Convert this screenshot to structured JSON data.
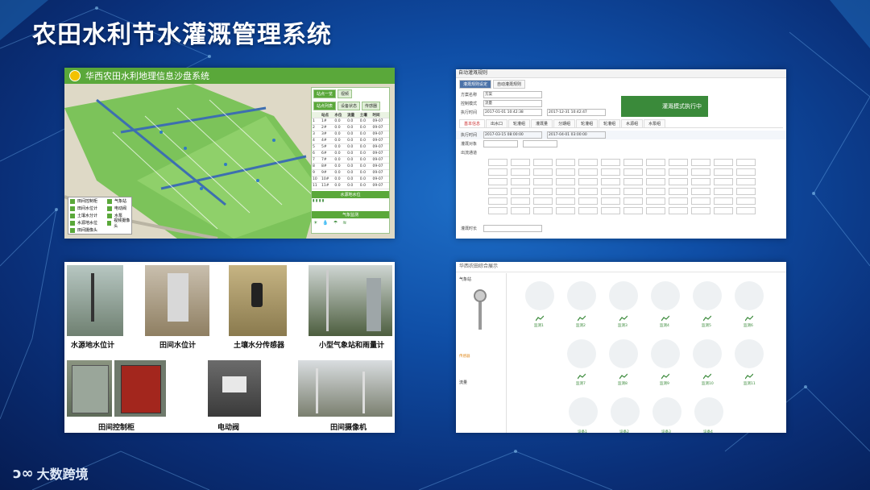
{
  "slide_title": "农田水利节水灌溉管理系统",
  "brand": "大数跨境",
  "gis": {
    "window_title": "华西农田水利地理信息沙盘系统",
    "tabs": [
      "站点一览",
      "视频"
    ],
    "sub_tabs": [
      "站点列表",
      "设备状态",
      "传感器"
    ],
    "table_header": [
      "",
      "站点",
      "水位",
      "流量",
      "土壤",
      "时间"
    ],
    "rows": [
      [
        "1",
        "1#",
        "0.0",
        "0.0",
        "0.0",
        "09-07"
      ],
      [
        "2",
        "2#",
        "0.0",
        "0.0",
        "0.0",
        "09-07"
      ],
      [
        "3",
        "3#",
        "0.0",
        "0.0",
        "0.0",
        "09-07"
      ],
      [
        "4",
        "4#",
        "0.0",
        "0.0",
        "0.0",
        "09-07"
      ],
      [
        "5",
        "5#",
        "0.0",
        "0.0",
        "0.0",
        "09-07"
      ],
      [
        "6",
        "6#",
        "0.0",
        "0.0",
        "0.0",
        "09-07"
      ],
      [
        "7",
        "7#",
        "0.0",
        "0.0",
        "0.0",
        "09-07"
      ],
      [
        "8",
        "8#",
        "0.0",
        "0.0",
        "0.0",
        "09-07"
      ],
      [
        "9",
        "9#",
        "0.0",
        "0.0",
        "0.0",
        "09-07"
      ],
      [
        "10",
        "10#",
        "0.0",
        "0.0",
        "0.0",
        "09-07"
      ],
      [
        "11",
        "11#",
        "0.0",
        "0.0",
        "0.0",
        "09-07"
      ]
    ],
    "section_water": "水源地水位",
    "section_weather": "气象监测",
    "legend": [
      "田间控制柜",
      "田间水位计",
      "土壤水分计",
      "水源地水位",
      "田间摄像头"
    ],
    "legend_right": [
      "气象站",
      "电动阀",
      "水泵",
      "视频摄像头"
    ]
  },
  "form": {
    "window_title": "自动灌溉规则",
    "tabs": [
      "灌溉规则设定",
      "自动灌溉规则"
    ],
    "fields": [
      {
        "label": "方案名称",
        "value": "方案"
      },
      {
        "label": "控制模式",
        "value": "流量"
      },
      {
        "label": "执行时间",
        "value": "2017-01-01 10:42:38"
      }
    ],
    "end_time": "2017-12-31 10:42:47",
    "run_status": "灌溉模式执行中",
    "sub_tabs": [
      "基本信息",
      "出水口",
      "轮灌组",
      "灌溉量",
      "分期组",
      "轮灌组",
      "轮灌组",
      "水源组",
      "水泵组"
    ],
    "time_label": "执行时间",
    "time_start": "2017-03-15 08:00:00",
    "time_end": "2017-04-01 03:00:00",
    "labels": [
      "灌溉对象",
      "出流通道",
      "灌溉时长"
    ]
  },
  "photos": {
    "captions": [
      "水源地水位计",
      "田间水位计",
      "土壤水分传感器",
      "小型气象站和雨量计",
      "田间控制柜",
      "电动阀",
      "田间摄像机"
    ]
  },
  "dash": {
    "window_title": "华西农田综合展示",
    "left_labels": [
      "气象站",
      "传感器",
      "流量"
    ],
    "gauges": [
      "监测1",
      "监测2",
      "监测3",
      "监测4",
      "监测5",
      "监测6",
      "监测7",
      "监测8",
      "监测9",
      "监测10",
      "监测11"
    ],
    "bottom": [
      "设备1",
      "设备2",
      "设备3",
      "设备4"
    ]
  }
}
